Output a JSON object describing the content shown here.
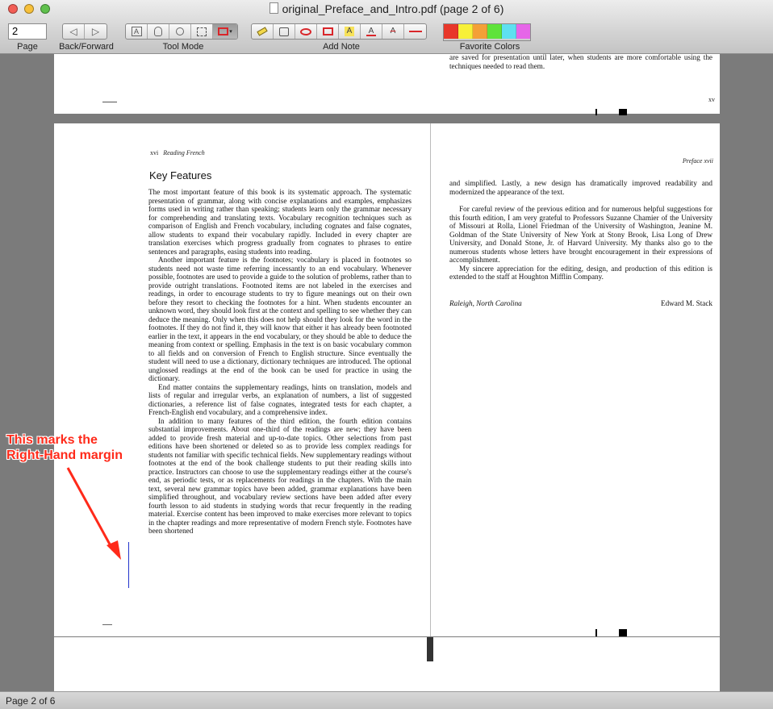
{
  "window": {
    "title": "original_Preface_and_Intro.pdf (page 2 of 6)",
    "status": "Page 2 of 6"
  },
  "toolbar": {
    "page_value": "2",
    "page_label": "Page",
    "backforward_label": "Back/Forward",
    "toolmode_label": "Tool Mode",
    "addnote_label": "Add Note",
    "favcolors_label": "Favorite Colors",
    "back_glyph": "◁",
    "forward_glyph": "▷",
    "favorite_colors": [
      "#e8372a",
      "#f7f038",
      "#f4a037",
      "#5fe33a",
      "#5ee0f0",
      "#e666e8"
    ]
  },
  "document": {
    "prev_page_text": "are saved for presentation until later, when students are more comfortable using the techniques needed to read them.",
    "prev_page_number": "xv",
    "left_header_num": "xvi",
    "left_header_title": "Reading French",
    "right_header": "Preface   xvii",
    "section_heading": "Key Features",
    "left_paragraphs": [
      "The most important feature of this book is its systematic approach. The systematic presentation of grammar, along with concise explanations and examples, emphasizes forms used in writing rather than speaking; students learn only the grammar necessary for comprehending and translating texts. Vocabulary recognition techniques such as comparison of English and French vocabulary, including cognates and false cognates, allow students to expand their vocabulary rapidly. Included in every chapter are translation exercises which progress gradually from cognates to phrases to entire sentences and paragraphs, easing students into reading.",
      "Another important feature is the footnotes; vocabulary is placed in footnotes so students need not waste time referring incessantly to an end vocabulary. Whenever possible, footnotes are used to provide a guide to the solution of problems, rather than to provide outright translations. Footnoted items are not labeled in the exercises and readings, in order to encourage students to try to figure meanings out on their own before they resort to checking the footnotes for a hint. When students encounter an unknown word, they should look first at the context and spelling to see whether they can deduce the meaning. Only when this does not help should they look for the word in the footnotes. If they do not find it, they will know that either it has already been footnoted earlier in the text, it appears in the end vocabulary, or they should be able to deduce the meaning from context or spelling. Emphasis in the text is on basic vocabulary common to all fields and on conversion of French to English structure. Since eventually the student will need to use a dictionary, dictionary techniques are introduced. The optional unglossed readings at the end of the book can be used for practice in using the dictionary.",
      "End matter contains the supplementary readings, hints on translation, models and lists of regular and irregular verbs, an explanation of numbers, a list of suggested dictionaries, a reference list of false cognates, integrated tests for each chapter, a French-English end vocabulary, and a comprehensive index.",
      "In addition to many features of the third edition, the fourth edition contains substantial improvements. About one-third of the readings are new; they have been added to provide fresh material and up-to-date topics. Other selections from past editions have been shortened or deleted so as to provide less complex readings for students not familiar with specific technical fields. New supplementary readings without footnotes at the end of the book challenge students to put their reading skills into practice. Instructors can choose to use the supplementary readings either at the course's end, as periodic tests, or as replacements for readings in the chapters. With the main text, several new grammar topics have been added, grammar explanations have been simplified throughout, and vocabulary review sections have been added after every fourth lesson to aid students in studying words that recur frequently in the reading material. Exercise content has been improved to make exercises more relevant to topics in the chapter readings and more representative of modern French style. Footnotes have been shortened"
    ],
    "right_paragraphs": [
      "and simplified. Lastly, a new design has dramatically improved readability and modernized the appearance of the text.",
      "For careful review of the previous edition and for numerous helpful suggestions for this fourth edition, I am very grateful to Professors Suzanne Chamier of the University of Missouri at Rolla, Lionel Friedman of the University of Washington, Jeanine M. Goldman of the State University of New York at Stony Brook, Lisa Long of Drew University, and Donald Stone, Jr. of Harvard University. My thanks also go to the numerous students whose letters have brought encouragement in their expressions of accomplishment.",
      "My sincere appreciation for the editing, design, and production of this edition is extended to the staff at Houghton Mifflin Company."
    ],
    "signature_place": "Raleigh, North Carolina",
    "signature_name": "Edward M. Stack"
  },
  "annotation": {
    "line1": "This marks the",
    "line2": "Right-Hand margin",
    "color": "#ff2a1a"
  }
}
